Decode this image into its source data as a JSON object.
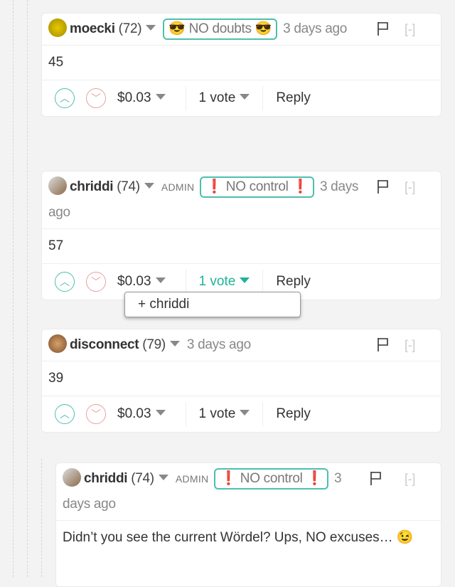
{
  "comments": [
    {
      "user": "moecki",
      "rep": "(72)",
      "admin": "",
      "badge": "😎 NO doubts 😎",
      "time": "3 days ago",
      "body": "45",
      "payout": "$0.03",
      "votes": "1 vote",
      "reply": "Reply",
      "collapse": "[-]"
    },
    {
      "user": "chriddi",
      "rep": "(74)",
      "admin": "ADMIN",
      "badge": "❗ NO control ❗",
      "time": "3 days ago",
      "body": "57",
      "payout": "$0.03",
      "votes": "1 vote",
      "reply": "Reply",
      "collapse": "[-]"
    },
    {
      "user": "disconnect",
      "rep": "(79)",
      "admin": "",
      "badge": "",
      "time": "3 days ago",
      "body": "39",
      "payout": "$0.03",
      "votes": "1 vote",
      "reply": "Reply",
      "collapse": "[-]"
    },
    {
      "user": "chriddi",
      "rep": "(74)",
      "admin": "ADMIN",
      "badge": "❗ NO control ❗",
      "time": "3 days ago",
      "body": "Didn’t you see the current Wördel? Ups, NO excuses… 😉",
      "collapse": "[-]"
    }
  ],
  "voters_popup": {
    "item": "+ chriddi"
  },
  "colors": {
    "accent": "#1fb39a",
    "badge_border": "#4dbfae",
    "downvote": "#e8a0a0"
  }
}
